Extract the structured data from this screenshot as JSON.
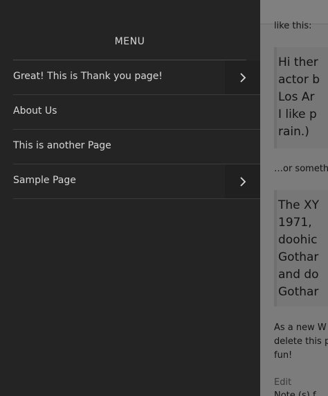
{
  "menu": {
    "title": "MENU",
    "items": [
      {
        "label": "Great! This is Thank you page!",
        "has_submenu": true
      },
      {
        "label": "About Us",
        "has_submenu": false
      },
      {
        "label": "This is another Page",
        "has_submenu": false
      },
      {
        "label": "Sample Page",
        "has_submenu": true
      }
    ],
    "submenu_icon": "chevron-right-icon"
  },
  "page": {
    "lines": {
      "top_partial": "like this:",
      "quote1": [
        "Hi ther",
        "actor b",
        "Los Ar",
        "I like p",
        "rain.)"
      ],
      "or_something": "…or someth",
      "quote2": [
        "The XY",
        "1971,",
        "doohic",
        "Gothar",
        "and do",
        "Gothar"
      ],
      "para": [
        "As a new W",
        "delete this p",
        "fun!"
      ],
      "edit": "Edit",
      "bottom_partial": "Note (s) f"
    }
  },
  "colors": {
    "drawer_bg": "#242424",
    "page_overlay": "#7c7c7c",
    "menu_text": "#d8d8d8"
  }
}
